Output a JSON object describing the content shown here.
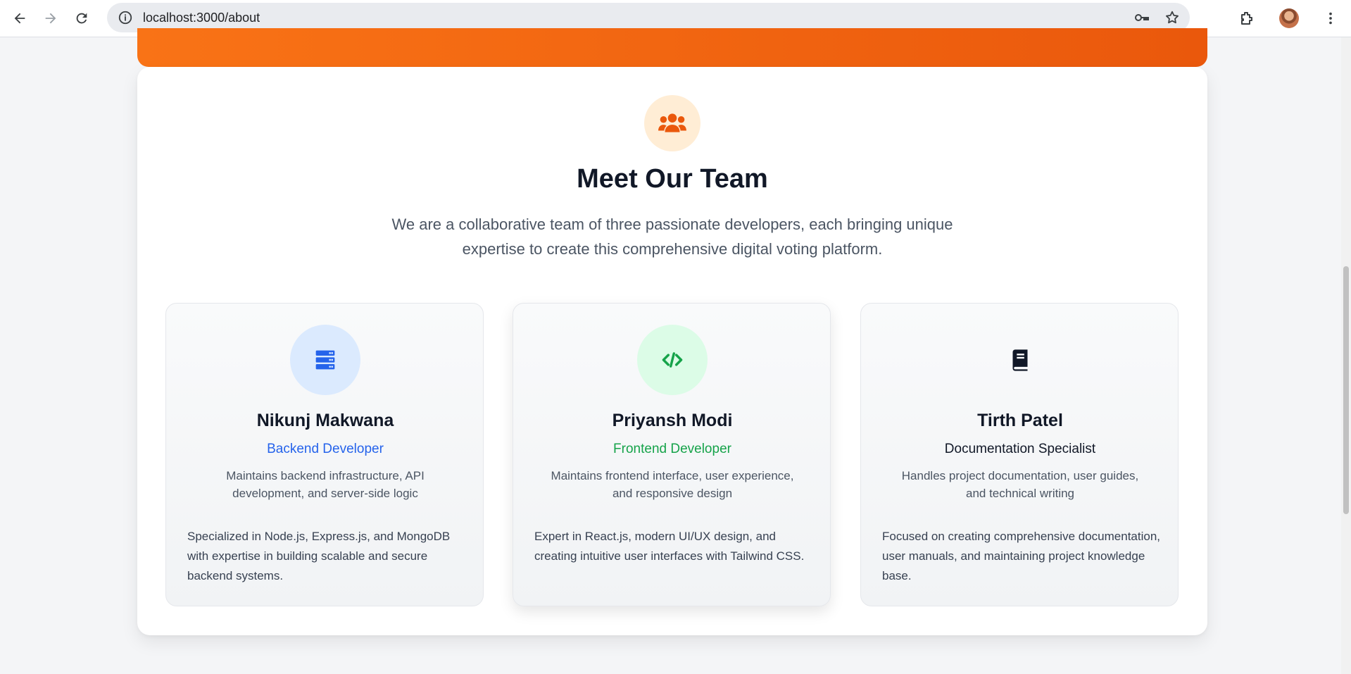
{
  "browser": {
    "url": "localhost:3000/about"
  },
  "team_section": {
    "title": "Meet Our Team",
    "description": "We are a collaborative team of three passionate developers, each bringing unique expertise to create this comprehensive digital voting platform."
  },
  "members": [
    {
      "name": "Nikunj Makwana",
      "role": "Backend Developer",
      "summary": "Maintains backend infrastructure, API development, and server-side logic",
      "detail": "Specialized in Node.js, Express.js, and MongoDB with expertise in building scalable and secure backend systems.",
      "icon": "server-icon",
      "accent": "#2563eb"
    },
    {
      "name": "Priyansh Modi",
      "role": "Frontend Developer",
      "summary": "Maintains frontend interface, user experience, and responsive design",
      "detail": "Expert in React.js, modern UI/UX design, and creating intuitive user interfaces with Tailwind CSS.",
      "icon": "code-icon",
      "accent": "#16a34a"
    },
    {
      "name": "Tirth Patel",
      "role": "Documentation Specialist",
      "summary": "Handles project documentation, user guides, and technical writing",
      "detail": "Focused on creating comprehensive documentation, user manuals, and maintaining project knowledge base.",
      "icon": "book-icon",
      "accent": "#111827"
    }
  ],
  "colors": {
    "banner": "#f97316",
    "team_icon": "#ea580c"
  }
}
